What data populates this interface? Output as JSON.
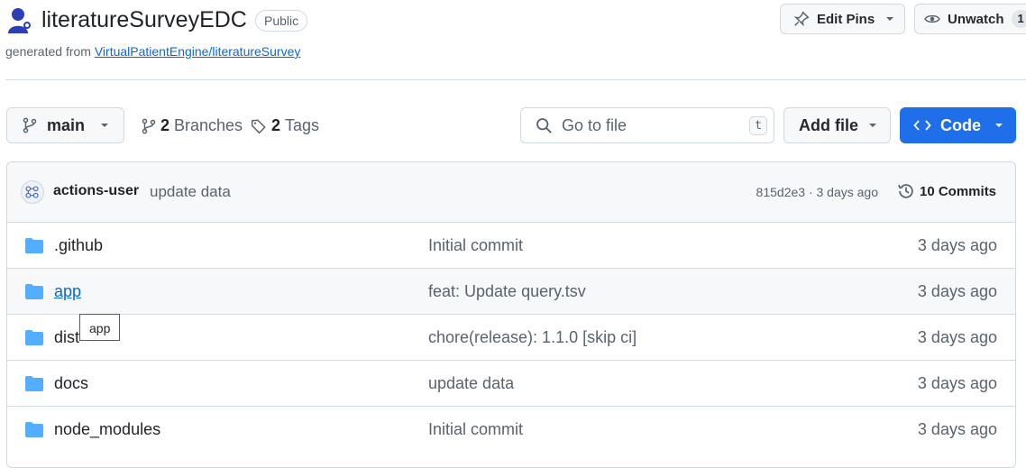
{
  "repo": {
    "name": "literatureSurveyEDC",
    "visibility": "Public",
    "generated_prefix": "generated from",
    "generated_link": "VirtualPatientEngine/literatureSurvey"
  },
  "header_actions": {
    "edit_pins_label": "Edit Pins",
    "unwatch_label": "Unwatch",
    "unwatch_count": "1"
  },
  "toolbar": {
    "branch": "main",
    "branches_count": "2",
    "branches_label": "Branches",
    "tags_count": "2",
    "tags_label": "Tags",
    "search_placeholder": "Go to file",
    "search_shortcut": "t",
    "add_file_label": "Add file",
    "code_label": "Code"
  },
  "latest_commit": {
    "author": "actions-user",
    "message": "update data",
    "sha_time": "815d2e3 · 3 days ago",
    "commits_label": "10 Commits"
  },
  "files": [
    {
      "name": ".github",
      "message": "Initial commit",
      "age": "3 days ago"
    },
    {
      "name": "app",
      "message": "feat: Update query.tsv",
      "age": "3 days ago"
    },
    {
      "name": "dist",
      "message": "chore(release): 1.1.0 [skip ci]",
      "age": "3 days ago"
    },
    {
      "name": "docs",
      "message": "update data",
      "age": "3 days ago"
    },
    {
      "name": "node_modules",
      "message": "Initial commit",
      "age": "3 days ago"
    }
  ],
  "tooltip": {
    "text": "app"
  },
  "colors": {
    "accent": "#1f6feb",
    "link": "#0969da",
    "folder": "#54aeff"
  }
}
